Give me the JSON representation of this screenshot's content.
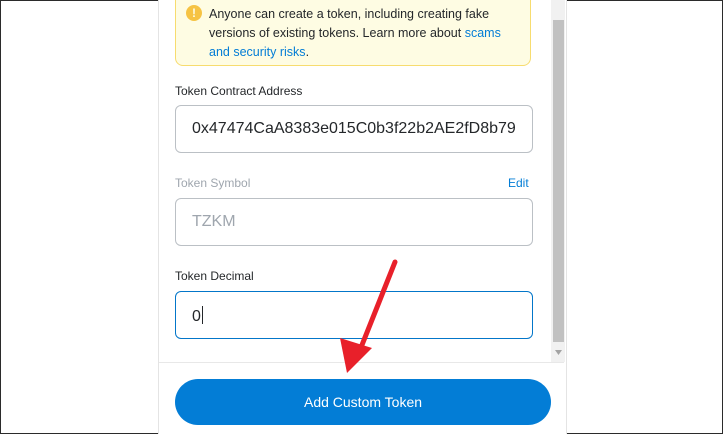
{
  "warning": {
    "icon": "warning-icon",
    "text": "Anyone can create a token, including creating fake versions of existing tokens. Learn more about ",
    "link": "scams and security risks",
    "end": "."
  },
  "contract_address": {
    "label": "Token Contract Address",
    "value": "0x47474CaA8383e015C0b3f22b2AE2fD8b79"
  },
  "symbol": {
    "label": "Token Symbol",
    "edit": "Edit",
    "value": "TZKM"
  },
  "decimal": {
    "label": "Token Decimal",
    "value": "0"
  },
  "add_button": "Add Custom Token",
  "colors": {
    "accent": "#037dd6",
    "warning_bg": "#fefce3",
    "annotation_arrow": "#e8202a"
  }
}
